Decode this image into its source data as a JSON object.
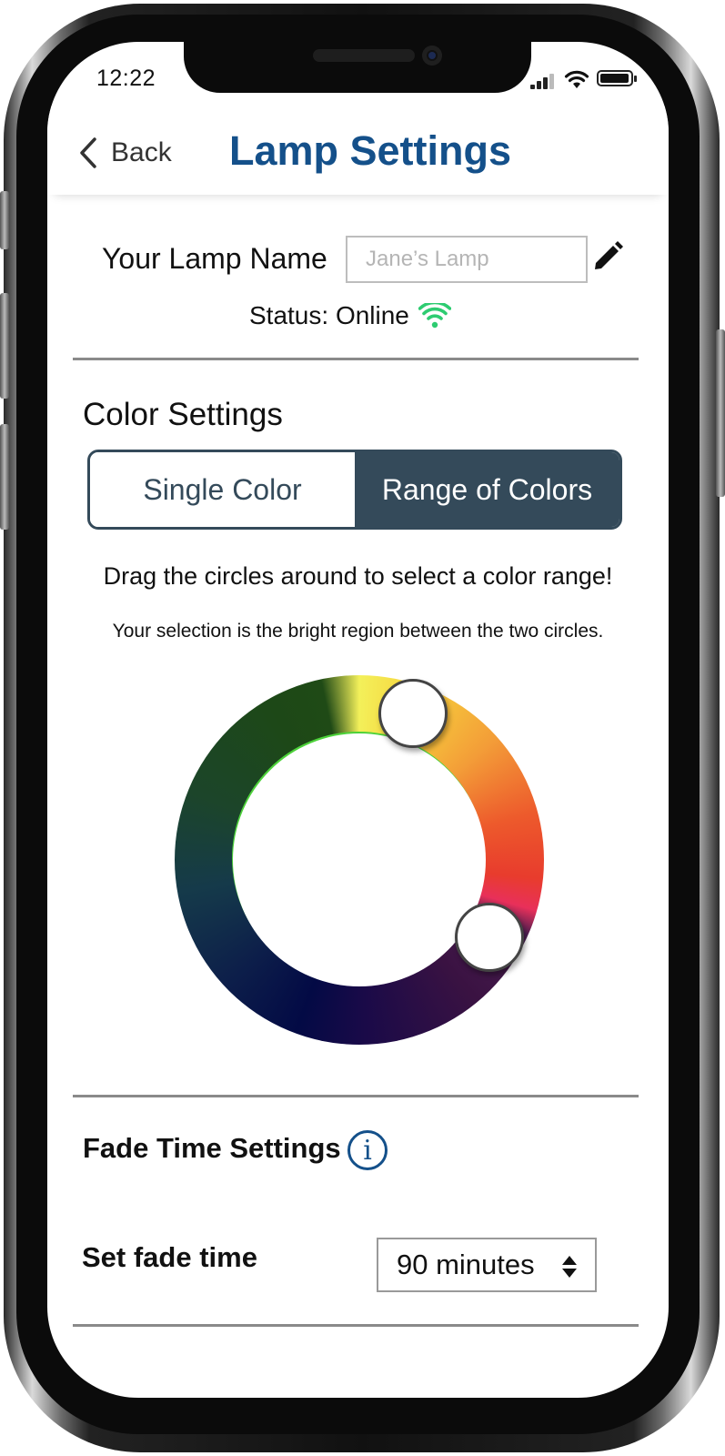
{
  "status_bar": {
    "time": "12:22"
  },
  "header": {
    "back_label": "Back",
    "title": "Lamp Settings"
  },
  "lamp": {
    "name_label": "Your Lamp Name",
    "name_placeholder": "Jane’s Lamp",
    "status_text": "Status: Online"
  },
  "color_settings": {
    "title": "Color Settings",
    "options": [
      "Single Color",
      "Range of Colors"
    ],
    "selected": "Range of Colors",
    "instruction": "Drag the circles around to select a color range!",
    "sub_instruction": "Your selection is the bright region between the two circles."
  },
  "fade": {
    "title": "Fade Time Settings",
    "info_symbol": "i",
    "label": "Set fade time",
    "value": "90 minutes"
  },
  "colors": {
    "title_blue": "#14508a",
    "toggle_dark": "#344a5a",
    "online_green": "#2ecc71"
  },
  "icons": [
    "chevron-left-icon",
    "pencil-icon",
    "wifi-icon",
    "info-icon",
    "sort-icon",
    "battery-icon",
    "signal-icon"
  ]
}
